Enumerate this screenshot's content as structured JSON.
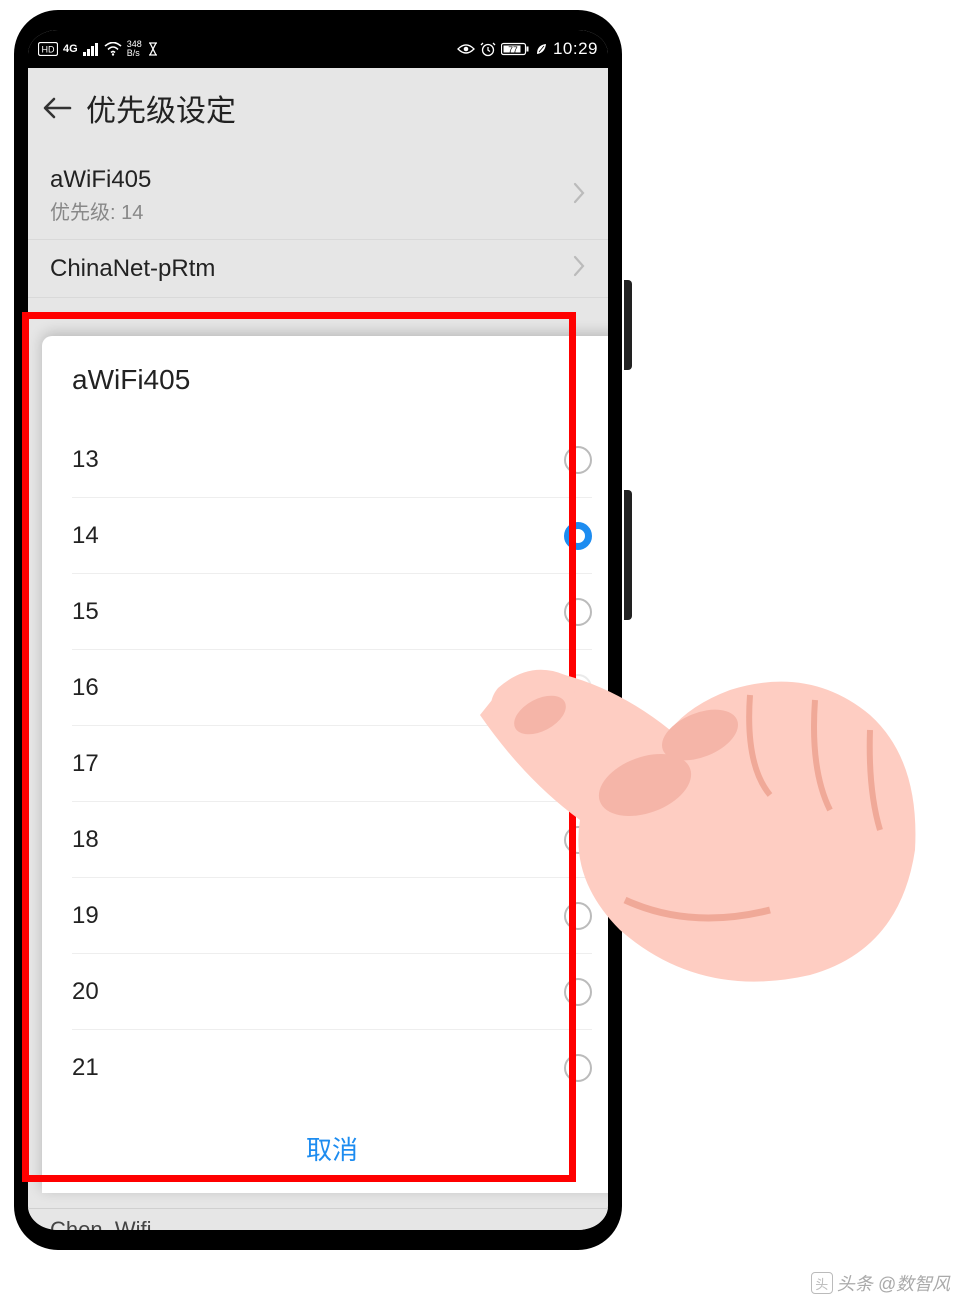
{
  "status_bar": {
    "hd_icon": "hd-icon",
    "signal": "4G",
    "net_up": "348",
    "net_dn": "B/s",
    "time": "10:29"
  },
  "header": {
    "title": "优先级设定"
  },
  "wifi_list": [
    {
      "name": "aWiFi405",
      "sub": "优先级: 14"
    },
    {
      "name": "ChinaNet-pRtm",
      "sub": ""
    }
  ],
  "partial_item": "Chen_Wifi",
  "dialog": {
    "title": "aWiFi405",
    "options": [
      {
        "label": "13",
        "selected": false
      },
      {
        "label": "14",
        "selected": true
      },
      {
        "label": "15",
        "selected": false
      },
      {
        "label": "16",
        "selected": false
      },
      {
        "label": "17",
        "selected": false
      },
      {
        "label": "18",
        "selected": false
      },
      {
        "label": "19",
        "selected": false
      },
      {
        "label": "20",
        "selected": false
      },
      {
        "label": "21",
        "selected": false
      }
    ],
    "cancel": "取消"
  },
  "watermark": "头条 @数智风"
}
